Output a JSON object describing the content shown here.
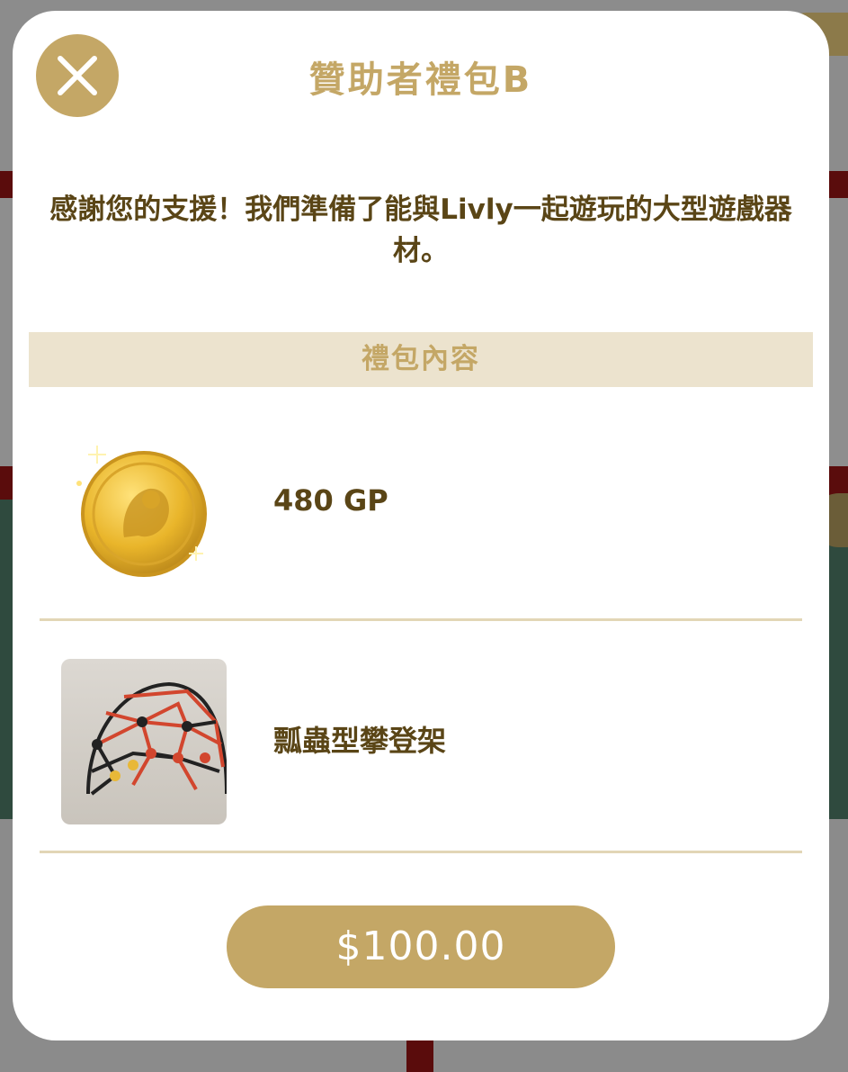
{
  "modal": {
    "title": "贊助者禮包B",
    "description": "感謝您的支援！我們準備了能與Livly一起遊玩的大型遊戲器材。",
    "section_header": "禮包內容",
    "items": [
      {
        "label": "480 GP",
        "icon": "gold-coin-icon"
      },
      {
        "label": "瓢蟲型攀登架",
        "icon": "ladybug-dome-climber-icon"
      }
    ],
    "price": "$100.00",
    "close_icon": "close-icon"
  },
  "colors": {
    "accent_gold": "#c4a766",
    "text_brown": "#5a4516",
    "section_bg": "#ece3ce",
    "overlay": "#8a8a8a"
  }
}
